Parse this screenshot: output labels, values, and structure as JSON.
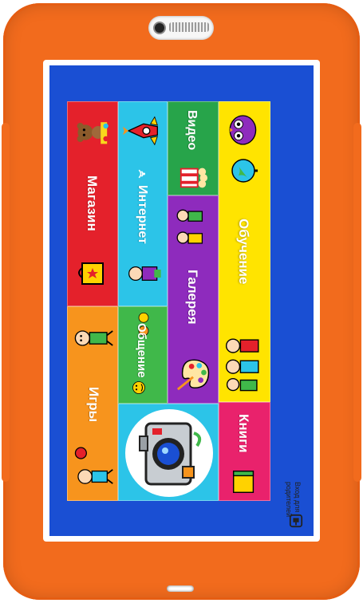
{
  "device": {
    "frame_color": "#f26b1d",
    "screen_bg": "#1a4fd3"
  },
  "tiles": {
    "shop": {
      "label": "Магазин",
      "color": "#e4212b",
      "icon": "teddy-bear-and-bag-icon"
    },
    "games": {
      "label": "Игры",
      "color": "#f7941d",
      "icon": "kids-with-ball-icon"
    },
    "internet": {
      "label": "Интернет",
      "color": "#2cc4e8",
      "icon": "rocket-icon"
    },
    "chat": {
      "label": "Общение",
      "color": "#40b84a",
      "icon": "smiley-faces-icon"
    },
    "video": {
      "label": "Видео",
      "color": "#27a44a",
      "icon": "popcorn-icon"
    },
    "gallery": {
      "label": "Галерея",
      "color": "#8e2bbd",
      "icon": "palette-icon"
    },
    "learning": {
      "label": "Обучение",
      "color": "#ffe400",
      "icon": "owl-and-globe-icon"
    },
    "books": {
      "label": "Книги",
      "color": "#e9226c",
      "icon": "book-icon"
    },
    "camera": {
      "icon": "camera-icon"
    }
  },
  "parent_login": {
    "line1": "Вход",
    "line2": "для родителей"
  }
}
